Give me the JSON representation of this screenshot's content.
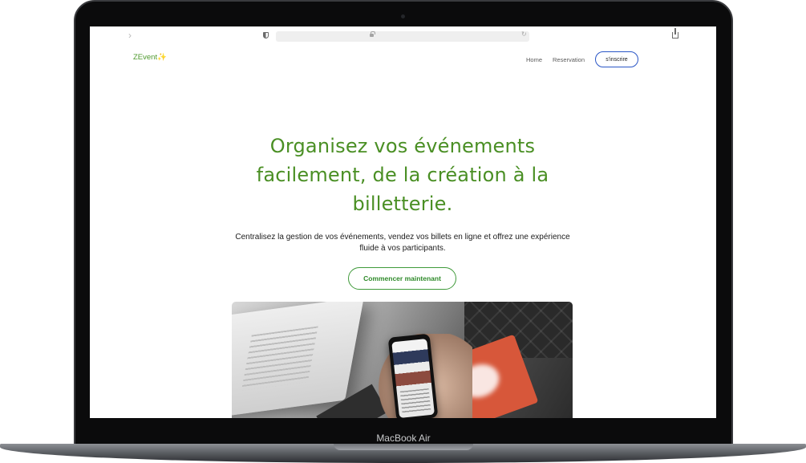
{
  "device": {
    "label": "MacBook Air"
  },
  "browser": {
    "back_glyph": "›",
    "reload_glyph": "↻"
  },
  "site": {
    "logo": "ZEvent✨",
    "nav": {
      "home": "Home",
      "reservation": "Reservation",
      "signup": "s'inscrire"
    }
  },
  "hero": {
    "title": "Organisez vos événements facilement, de la création à la billetterie.",
    "subtitle": "Centralisez la gestion de vos événements, vendez vos billets en ligne et offrez une expérience fluide à vos participants.",
    "cta": "Commencer maintenant"
  },
  "colors": {
    "brand_green": "#4a8f24",
    "signup_border": "#2a56c6",
    "cta_border": "#3f9a3a"
  },
  "icons": [
    "chevron-right-icon",
    "shield-icon",
    "lock-icon",
    "reload-icon",
    "share-icon",
    "sparkle-icon"
  ]
}
